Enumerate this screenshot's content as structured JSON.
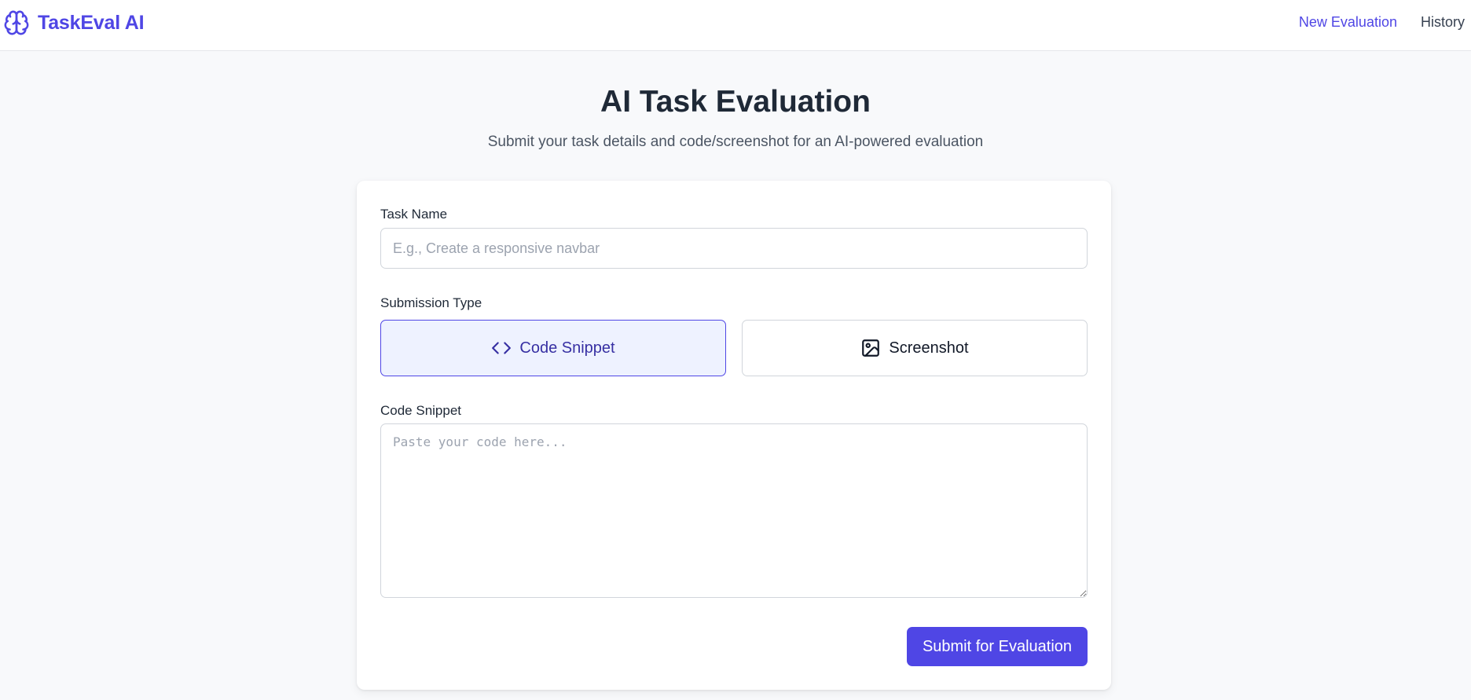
{
  "app": {
    "name": "TaskEval AI",
    "brand_icon": "brain-icon",
    "accent_color": "#4f46e5"
  },
  "nav": {
    "items": [
      {
        "label": "New Evaluation",
        "active": true
      },
      {
        "label": "History",
        "active": false
      }
    ]
  },
  "hero": {
    "title": "AI Task Evaluation",
    "subtitle": "Submit your task details and code/screenshot for an AI-powered evaluation"
  },
  "form": {
    "task_name": {
      "label": "Task Name",
      "value": "",
      "placeholder": "E.g., Create a responsive navbar"
    },
    "submission_type": {
      "label": "Submission Type",
      "options": [
        {
          "label": "Code Snippet",
          "icon": "code-icon",
          "selected": true
        },
        {
          "label": "Screenshot",
          "icon": "image-icon",
          "selected": false
        }
      ]
    },
    "code_snippet": {
      "label": "Code Snippet",
      "value": "",
      "placeholder": "Paste your code here..."
    },
    "submit_label": "Submit for Evaluation"
  }
}
